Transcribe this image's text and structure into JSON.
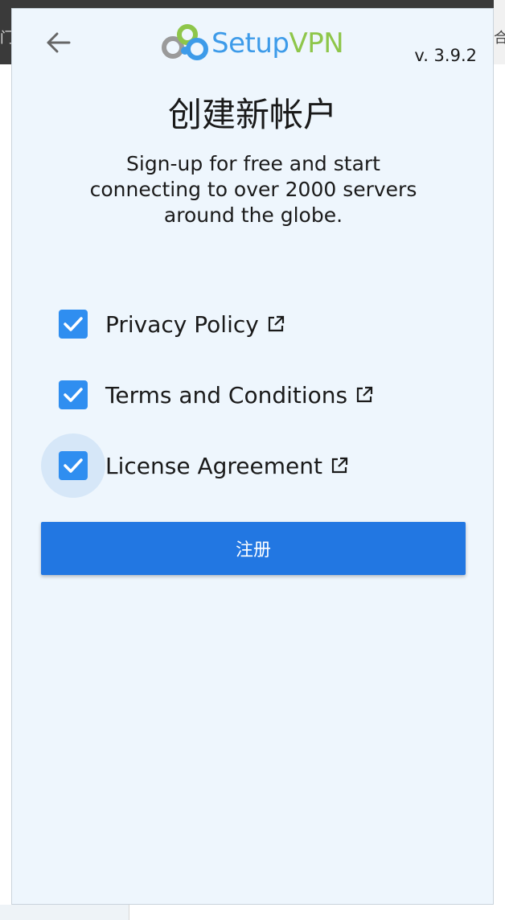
{
  "browser": {
    "left_glyph": "门",
    "right_glyph": "合"
  },
  "header": {
    "back_icon": "arrow-left-icon",
    "logo": {
      "setup": "Setup",
      "vpn": "VPN"
    },
    "version": "v. 3.9.2"
  },
  "main": {
    "title": "创建新帐户",
    "subtitle": "Sign-up for free and start connecting to over 2000 servers around the globe."
  },
  "agreements": [
    {
      "label": "Privacy Policy",
      "checked": true,
      "icon": "external-link-icon"
    },
    {
      "label": "Terms and Conditions",
      "checked": true,
      "icon": "external-link-icon"
    },
    {
      "label": "License Agreement",
      "checked": true,
      "icon": "external-link-icon"
    }
  ],
  "signup": {
    "label": "注册"
  },
  "colors": {
    "accent": "#2277e2",
    "checkbox": "#2f8ef0",
    "logo_blue": "#3d9be9",
    "logo_green": "#8ec64a",
    "popup_bg": "#eef6fd"
  }
}
